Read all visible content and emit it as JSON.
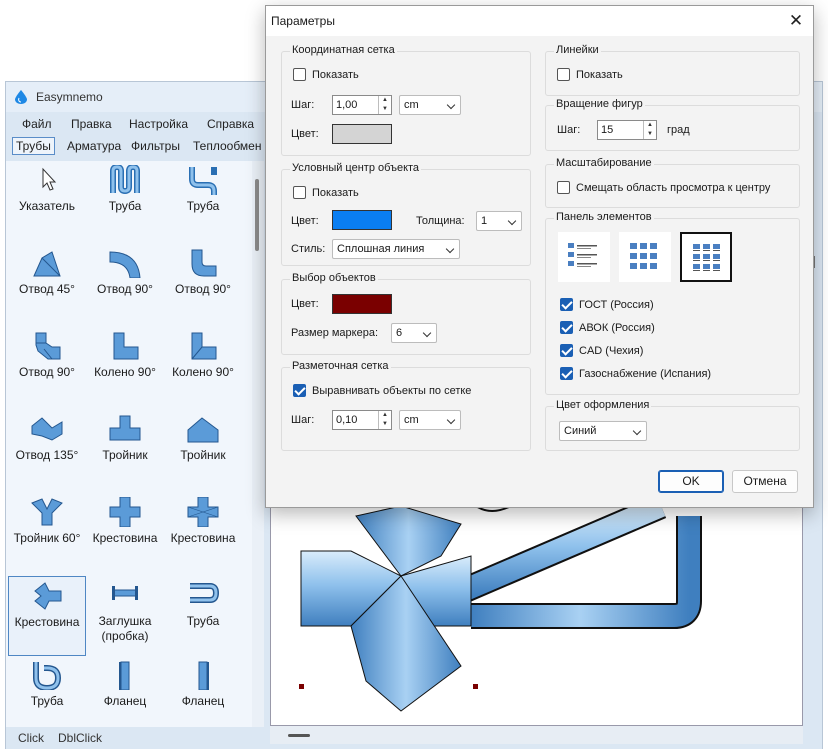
{
  "app": {
    "name": "Easymnemo",
    "menu": [
      "Файл",
      "Правка",
      "Настройка",
      "Справка"
    ],
    "tabs": [
      "Трубы",
      "Арматура",
      "Фильтры",
      "Теплообмен"
    ],
    "tools": [
      {
        "label": "Указатель",
        "icon": "pointer-icon"
      },
      {
        "label": "Труба",
        "icon": "pipe-u-icon"
      },
      {
        "label": "Труба",
        "icon": "pipe-s-icon"
      },
      {
        "label": "Отвод 45°",
        "icon": "bend-45-icon"
      },
      {
        "label": "Отвод 90°",
        "icon": "bend-90-icon"
      },
      {
        "label": "Отвод 90°",
        "icon": "bend-90-square-icon"
      },
      {
        "label": "Отвод 90°",
        "icon": "bend-90-segmented-icon"
      },
      {
        "label": "Колено 90°",
        "icon": "elbow-90-icon"
      },
      {
        "label": "Колено 90°",
        "icon": "elbow-90-alt-icon"
      },
      {
        "label": "Отвод 135°",
        "icon": "bend-135-icon"
      },
      {
        "label": "Тройник",
        "icon": "tee-icon"
      },
      {
        "label": "Тройник",
        "icon": "tee-angled-icon"
      },
      {
        "label": "Тройник 60°",
        "icon": "tee-60-icon"
      },
      {
        "label": "Крестовина",
        "icon": "cross-icon"
      },
      {
        "label": "Крестовина",
        "icon": "cross-alt-icon"
      },
      {
        "label": "Крестовина",
        "icon": "cross-angled-icon"
      },
      {
        "label": "Заглушка (пробка)",
        "icon": "plug-icon"
      },
      {
        "label": "Труба",
        "icon": "pipe-return-icon"
      },
      {
        "label": "Труба",
        "icon": "pipe-loop-icon"
      },
      {
        "label": "Фланец",
        "icon": "flange-icon"
      },
      {
        "label": "Фланец",
        "icon": "flange-alt-icon"
      }
    ],
    "status": [
      "Click",
      "DblClick"
    ]
  },
  "dialog": {
    "title": "Параметры",
    "close": "✕",
    "grid": {
      "title": "Координатная сетка",
      "show_label": "Показать",
      "show_checked": false,
      "step_label": "Шаг:",
      "step_value": "1,00",
      "unit": "cm",
      "color_label": "Цвет:",
      "color": "#d4d4d4"
    },
    "center": {
      "title": "Условный центр объекта",
      "show_label": "Показать",
      "show_checked": false,
      "color_label": "Цвет:",
      "color": "#0a7ef2",
      "thickness_label": "Толщина:",
      "thickness": "1",
      "style_label": "Стиль:",
      "style": "Сплошная линия"
    },
    "selection": {
      "title": "Выбор объектов",
      "color_label": "Цвет:",
      "color": "#7a0000",
      "marker_label": "Размер маркера:",
      "marker": "6"
    },
    "snap": {
      "title": "Разметочная сетка",
      "align_label": "Выравнивать объекты по сетке",
      "align_checked": true,
      "step_label": "Шаг:",
      "step_value": "0,10",
      "unit": "cm"
    },
    "rulers": {
      "title": "Линейки",
      "show_label": "Показать",
      "show_checked": false
    },
    "rotation": {
      "title": "Вращение фигур",
      "step_label": "Шаг:",
      "step_value": "15",
      "unit": "град"
    },
    "scaling": {
      "title": "Масштабирование",
      "shift_label": "Смещать область просмотра к центру",
      "shift_checked": false
    },
    "palette": {
      "title": "Панель элементов",
      "layouts": [
        "list-layout-icon",
        "grid-layout-icon",
        "grid-labels-layout-icon"
      ],
      "selected_layout": 2,
      "libraries": [
        {
          "label": "ГОСТ (Россия)",
          "checked": true
        },
        {
          "label": "АВОК (Россия)",
          "checked": true
        },
        {
          "label": "CAD (Чехия)",
          "checked": true
        },
        {
          "label": "Газоснабжение (Испания)",
          "checked": true
        }
      ]
    },
    "theme": {
      "title": "Цвет оформления",
      "value": "Синий"
    },
    "ok": "OK",
    "cancel": "Отмена"
  }
}
